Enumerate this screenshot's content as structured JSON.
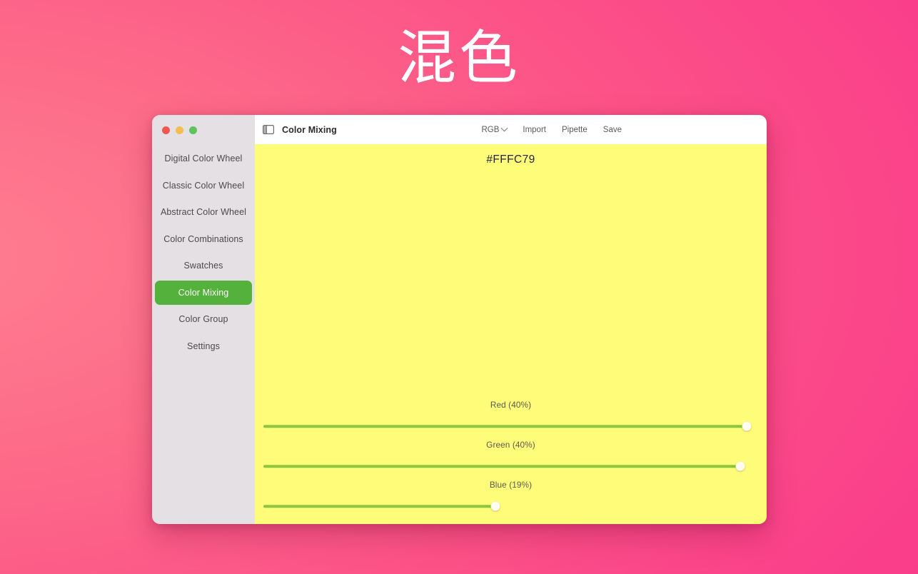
{
  "page": {
    "title": "混色",
    "background_start": "#FE7E90",
    "background_end": "#F93A8C"
  },
  "window": {
    "traffic_lights": [
      {
        "name": "close",
        "color": "#F0584F"
      },
      {
        "name": "minimize",
        "color": "#F5BD4F"
      },
      {
        "name": "maximize",
        "color": "#5EC45A"
      }
    ]
  },
  "sidebar": {
    "background": "#E4E0E3",
    "active_color": "#53B13C",
    "items": [
      {
        "label": "Digital Color Wheel",
        "active": false
      },
      {
        "label": "Classic Color Wheel",
        "active": false
      },
      {
        "label": "Abstract Color Wheel",
        "active": false
      },
      {
        "label": "Color Combinations",
        "active": false
      },
      {
        "label": "Swatches",
        "active": false
      },
      {
        "label": "Color Mixing",
        "active": true
      },
      {
        "label": "Color Group",
        "active": false
      },
      {
        "label": "Settings",
        "active": false
      }
    ]
  },
  "toolbar": {
    "sidebar_toggle_icon": "sidebar-toggle-icon",
    "title": "Color Mixing",
    "color_mode": "RGB",
    "import_label": "Import",
    "pipette_label": "Pipette",
    "save_label": "Save"
  },
  "canvas": {
    "hex_value": "#FFFC79",
    "fill_color": "#FFFC79",
    "track_color": "#8CC63E",
    "thumb_color": "#FDFCEE",
    "sliders": [
      {
        "name": "red",
        "label": "Red (40%)",
        "percent": 40,
        "fill_ratio": 0.975
      },
      {
        "name": "green",
        "label": "Green (40%)",
        "percent": 40,
        "fill_ratio": 0.962
      },
      {
        "name": "blue",
        "label": "Blue (19%)",
        "percent": 19,
        "fill_ratio": 0.468
      }
    ]
  }
}
